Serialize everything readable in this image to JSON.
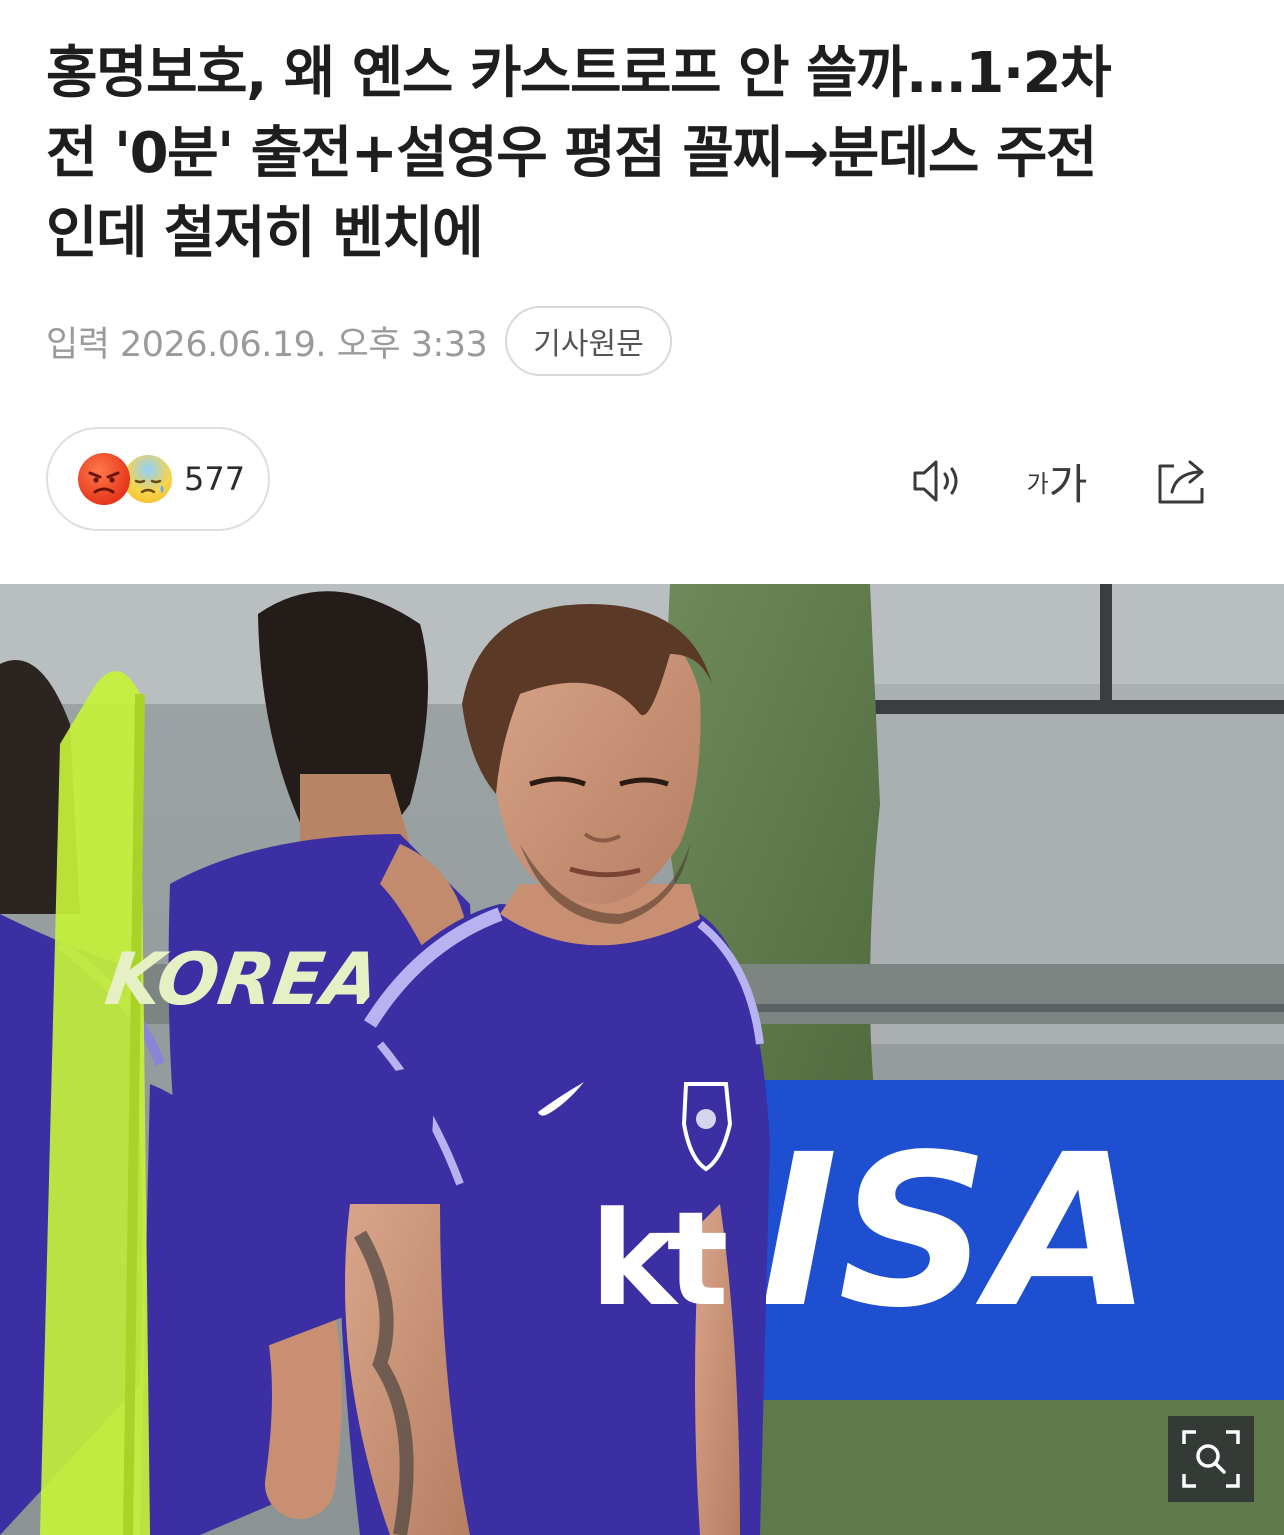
{
  "article": {
    "headline_line1": "홍명보호, 왜 옌스 카스트로프 안 쓸까...1·2차",
    "headline_line2": "전 '0분' 출전+설영우 평점 꼴찌→분데스 주전",
    "headline_line3": "인데 철저히 벤치에",
    "published": "입력 2026.06.19. 오후 3:33",
    "origin_button": "기사원문"
  },
  "reactions": {
    "count": "577",
    "emojis": [
      "angry-face",
      "sad-sweat-face"
    ]
  },
  "toolbar": {
    "speaker_icon": "speaker-icon",
    "font_small_label": "가",
    "font_big_label": "가",
    "share_icon": "share-icon"
  },
  "photo": {
    "jersey_text": "KOREA",
    "sponsor_text": "kt",
    "banner_text": "ISA",
    "zoom_icon": "zoom-icon"
  },
  "colors": {
    "jersey": "#3b2fa3",
    "banner": "#1f4fd1",
    "accent_green": "#c6f23a"
  }
}
